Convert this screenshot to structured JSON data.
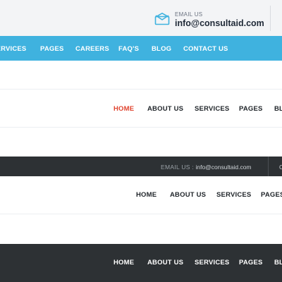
{
  "variant1": {
    "email_label": "EMAIL US",
    "email_value": "info@consultaid.com",
    "icon": "envelope-icon",
    "accent_color": "#3fb2df",
    "nav": [
      "SERVICES",
      "PAGES",
      "CAREERS",
      "FAQ'S",
      "BLOG",
      "CONTACT US"
    ]
  },
  "variant2": {
    "active_color": "#e0432e",
    "nav": [
      "HOME",
      "ABOUT US",
      "SERVICES",
      "PAGES",
      "BLOG"
    ]
  },
  "variant3": {
    "email_label": "EMAIL US :",
    "email_value": "info@consultaid.com",
    "nav": [
      "HOME",
      "ABOUT US",
      "SERVICES",
      "PAGES"
    ]
  },
  "variant4": {
    "bar_color": "#2d3134",
    "nav": [
      "HOME",
      "ABOUT US",
      "SERVICES",
      "PAGES",
      "BLOG"
    ]
  }
}
